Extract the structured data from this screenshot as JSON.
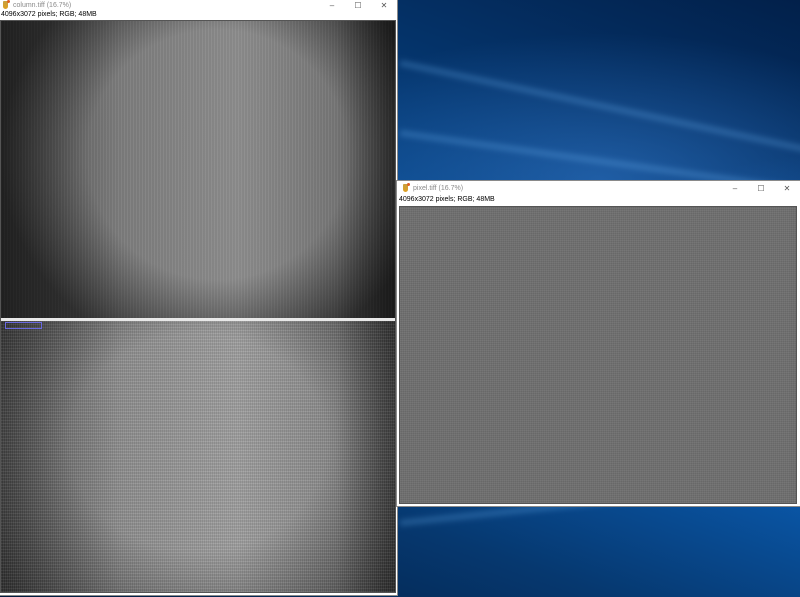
{
  "desktop": {
    "wallpaper": "windows-10-hero"
  },
  "windows": [
    {
      "id": "column",
      "title": "column.tiff (16.7%)",
      "info": "4096x3072 pixels; RGB; 48MB",
      "icon": "imagej-flask-icon",
      "controls": {
        "minimize": "–",
        "maximize": "☐",
        "close": "✕"
      }
    },
    {
      "id": "pixel",
      "title": "pixel.tiff (16.7%)",
      "info": "4096x3072 pixels; RGB; 48MB",
      "icon": "imagej-flask-icon",
      "controls": {
        "minimize": "–",
        "maximize": "☐",
        "close": "✕"
      }
    }
  ],
  "colors": {
    "roi_outline": "#6a6ae0",
    "title_text": "#8a8a8a"
  }
}
